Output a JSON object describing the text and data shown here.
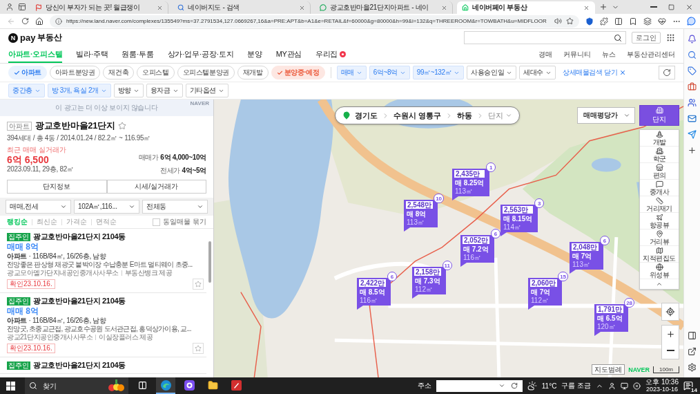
{
  "browser": {
    "tabs": [
      {
        "title": "당신이 부자가 되는 곳! 월급쟁이",
        "selected": false
      },
      {
        "title": "네이버지도 - 검색",
        "selected": false
      },
      {
        "title": "광교호반마을21단지아파트 - 네이",
        "selected": false
      },
      {
        "title": "네이버페이 부동산",
        "selected": true
      }
    ],
    "url": "https://new.land.naver.com/complexes/135549?ms=37.2791534,127.0669267,16&a=PRE:APT&b=A1&e=RETAIL&f=60000&g=80000&h=99&i=132&q=THREEROOM&r=TOWBATH&u=MIDFLOOR"
  },
  "header": {
    "logo_mark": "N",
    "brand": "pay",
    "service": "부동산",
    "login": "로그인"
  },
  "nav": {
    "items": [
      {
        "label": "아파트·오피스텔",
        "selected": true,
        "new": false
      },
      {
        "label": "빌라·주택",
        "selected": false,
        "new": false
      },
      {
        "label": "원룸·투룸",
        "selected": false,
        "new": false
      },
      {
        "label": "상가·업무·공장·토지",
        "selected": false,
        "new": false
      },
      {
        "label": "분양",
        "selected": false,
        "new": false
      },
      {
        "label": "MY관심",
        "selected": false,
        "new": false
      },
      {
        "label": "우리집",
        "selected": false,
        "new": true
      }
    ],
    "links": [
      "경매",
      "커뮤니티",
      "뉴스",
      "부동산관리센터"
    ]
  },
  "filters": {
    "types": [
      {
        "label": "아파트",
        "selected": true,
        "kind": "property"
      },
      {
        "label": "아파트분양권",
        "selected": false,
        "kind": "property"
      },
      {
        "label": "재건축",
        "selected": false,
        "kind": "property"
      },
      {
        "label": "오피스텔",
        "selected": false,
        "kind": "property"
      },
      {
        "label": "오피스텔분양권",
        "selected": false,
        "kind": "property"
      },
      {
        "label": "재개발",
        "selected": false,
        "kind": "property"
      },
      {
        "label": "분양중·예정",
        "selected": true,
        "kind": "presale"
      }
    ],
    "options": [
      {
        "label": "매매",
        "active": true
      },
      {
        "label": "6억~8억",
        "active": true
      },
      {
        "label": "99㎡~132㎡",
        "active": true
      },
      {
        "label": "사용승인일",
        "active": false
      },
      {
        "label": "세대수",
        "active": false
      }
    ],
    "close_detail": "상세매물검색 닫기",
    "details": [
      {
        "label": "중간층",
        "active": true
      },
      {
        "label": "방 3개, 욕실 2개",
        "active": true
      },
      {
        "label": "방향",
        "active": false
      },
      {
        "label": "융자금",
        "active": false
      },
      {
        "label": "기타옵션",
        "active": false
      }
    ]
  },
  "ad": {
    "text": "이 광고는 더 이상 보이지 않습니다",
    "label": "NAVER"
  },
  "complex": {
    "type": "아파트",
    "name": "광교호반마을21단지",
    "favorite": false,
    "summary": "394세대 / 총 4동 / 2014.01.24 / 82.2㎡ ~ 116.95㎡",
    "recent_label": "최근 매매 실거래가",
    "recent_price": "6억 6,500",
    "recent_detail": "2023.09.11, 29층, 82㎡",
    "prices": [
      {
        "label": "매매가",
        "value": "6억 4,000~10억"
      },
      {
        "label": "전세가",
        "value": "4억~5억"
      }
    ],
    "buttons": [
      "단지정보",
      "시세/실거래가"
    ]
  },
  "list_filters": [
    "매매,전세",
    "102A㎡,116...",
    "전체동"
  ],
  "sort": {
    "options": [
      {
        "label": "랭킹순",
        "selected": true
      },
      {
        "label": "최신순",
        "selected": false
      },
      {
        "label": "가격순",
        "selected": false
      },
      {
        "label": "면적순",
        "selected": false
      }
    ],
    "group": {
      "label": "동일매물 묶기",
      "checked": false
    }
  },
  "listings": [
    {
      "badge": "집주인",
      "title": "광교호반마을21단지 2104동",
      "price": "매매 8억",
      "specs": "**아파트** · 116B/84㎡, 16/26층, 남향",
      "description": "전망좋은 판상형 채광굿 붙박이장 수납충분 E마트 멀티웨이 초중...",
      "agency": "광교모아멜가단지내공인중개사사무소",
      "provider": "부동산뱅크 제공",
      "verified": "확인23.10.16.",
      "favorite": false
    },
    {
      "badge": "집주인",
      "title": "광교호반마을21단지 2104동",
      "price": "매매 8억",
      "specs": "**아파트** · 116B/84㎡, 16/26층, 남향",
      "description": "전망굿, 초중교근접, 광교호수공원 도서관근접, 흥덕상가이용, 교...",
      "agency": "광교21단지공인중개사사무소",
      "provider": "이실장플러스 제공",
      "verified": "확인23.10.16.",
      "favorite": false
    },
    {
      "badge": "집주인",
      "title": "광교호반마을21단지 2104동"
    }
  ],
  "map": {
    "breadcrumb": [
      "경기도",
      "수원시 영통구",
      "하동"
    ],
    "level": "단지",
    "price_mode": "매매평당가",
    "complex_toggle": {
      "label": "단지",
      "selected": true
    },
    "tools": [
      "개발",
      "학군",
      "편의",
      "중개사",
      "거리재기",
      "항공뷰",
      "거리뷰",
      "지적편집도",
      "위성뷰"
    ],
    "markers": [
      {
        "unit_price": "2,435만",
        "count": "1",
        "price": "매 8.25억",
        "area": "113㎡"
      },
      {
        "unit_price": "2,548만",
        "count": "10",
        "price": "매 8억",
        "area": "113㎡"
      },
      {
        "unit_price": "2,563만",
        "count": "3",
        "price": "매 8.15억",
        "area": "114㎡"
      },
      {
        "unit_price": "2,052만",
        "count": "6",
        "price": "매 7.2억",
        "area": "116㎡"
      },
      {
        "unit_price": "2,048만",
        "count": "6",
        "price": "매 7억",
        "area": "113㎡"
      },
      {
        "unit_price": "2,158만",
        "count": "11",
        "price": "매 7.3억",
        "area": "112㎡"
      },
      {
        "unit_price": "2,422만",
        "count": "6",
        "price": "매 8.5억",
        "area": "116㎡"
      },
      {
        "unit_price": "2,060만",
        "count": "15",
        "price": "매 7억",
        "area": "112㎡"
      },
      {
        "unit_price": "1,791만",
        "count": "28",
        "price": "매 6.5억",
        "area": "120㎡"
      }
    ],
    "legend": "지도범례",
    "brand": "NAVER",
    "scale": "100m"
  },
  "taskbar": {
    "search_placeholder": "찾기",
    "address_label": "주소",
    "temperature": "11°C",
    "weather": "구름 조금",
    "time": "오후 10:36",
    "date": "2023-10-16",
    "notifications": "14"
  }
}
